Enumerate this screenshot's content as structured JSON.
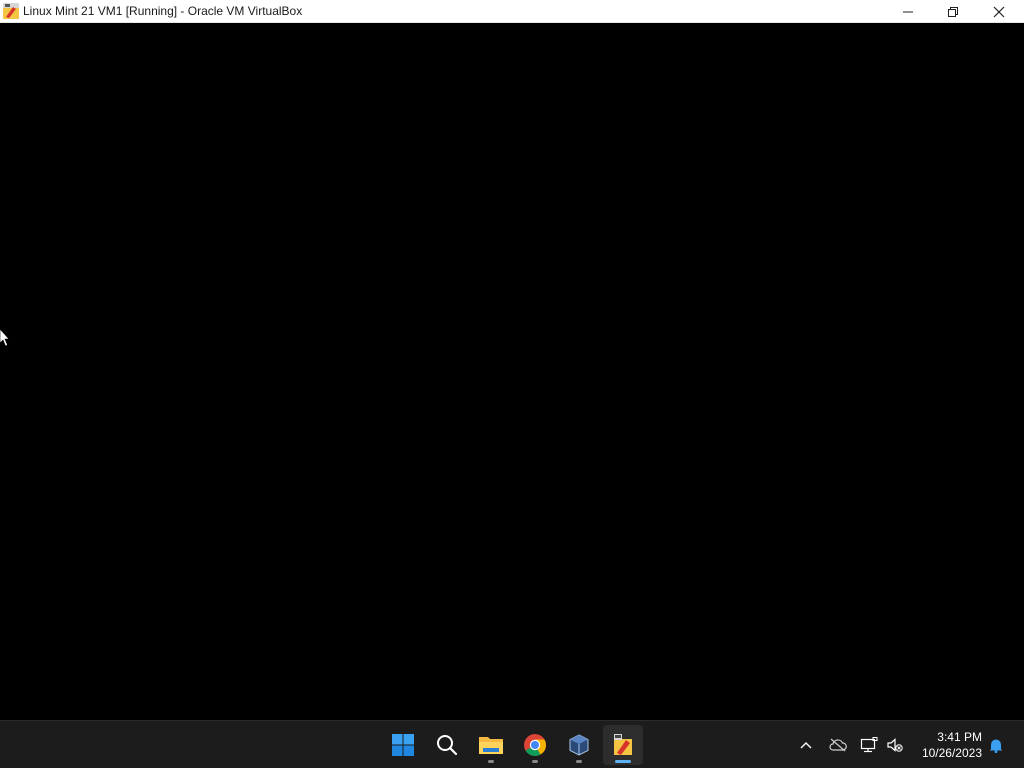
{
  "window": {
    "title": "Linux Mint 21 VM1 [Running] - Oracle VM VirtualBox",
    "icon": "virtualbox-vm-icon",
    "controls": [
      "minimize",
      "maximize",
      "close"
    ]
  },
  "vm_screen": {
    "background": "#000000",
    "cursor": "mouse-pointer-icon"
  },
  "taskbar": {
    "apps": [
      {
        "name": "start",
        "icon": "windows-start-icon"
      },
      {
        "name": "search",
        "icon": "search-icon"
      },
      {
        "name": "file-explorer",
        "icon": "folder-icon",
        "running": true
      },
      {
        "name": "chrome",
        "icon": "chrome-icon",
        "running": true
      },
      {
        "name": "virtualbox",
        "icon": "virtualbox-icon",
        "running": true
      },
      {
        "name": "vm-window",
        "icon": "virtualbox-vm-icon",
        "running": true,
        "active": true
      }
    ],
    "tray": {
      "icons": [
        "chevron-up-icon",
        "onedrive-offline-icon",
        "network-icon",
        "volume-muted-icon"
      ],
      "time": "3:41 PM",
      "date": "10/26/2023",
      "notification_icon": "bell-icon"
    },
    "accent": "#5fb2f2"
  }
}
